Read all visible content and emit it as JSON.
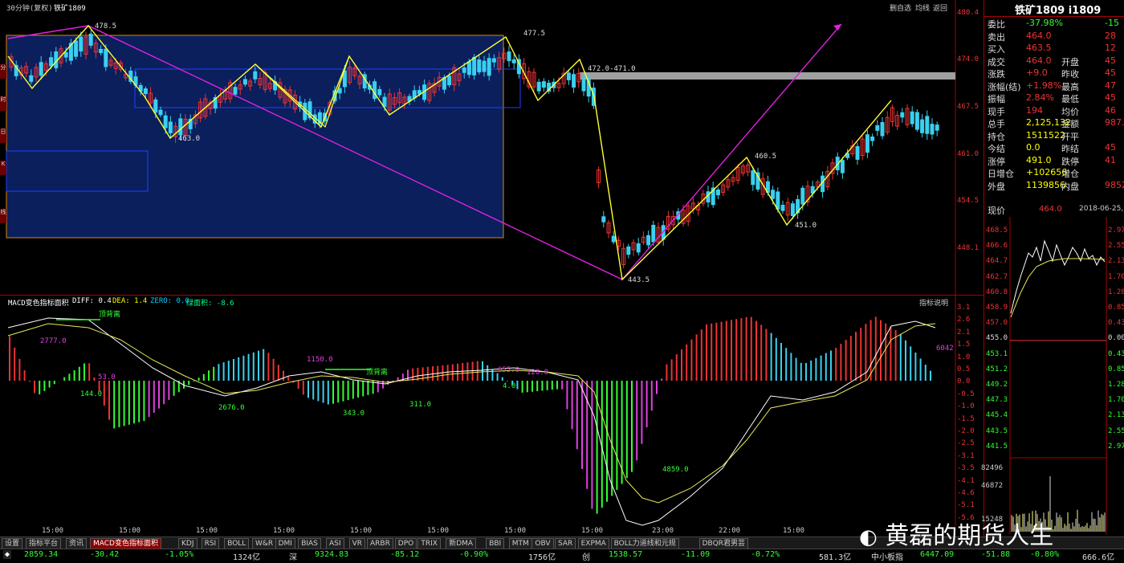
{
  "header": {
    "period": "30分钟(复权)",
    "symbol": "铁矿1809",
    "tools": [
      "删自选",
      "均线",
      "返回"
    ]
  },
  "price_axis": [
    "480.4",
    "474.0",
    "467.5",
    "461.0",
    "454.5",
    "448.1"
  ],
  "main_labels": {
    "p1": "478.5",
    "p2": "463.0",
    "p3": "477.5",
    "p4": "472.0-471.0",
    "p5": "443.5",
    "p6": "460.5",
    "p7": "451.0"
  },
  "macd": {
    "title": "MACD变色指标面积",
    "diff": "DIFF: 0.4",
    "dea": "DEA: 1.4",
    "zero": "ZERO: 0.0",
    "area": "绿面积: -8.6",
    "help": "指标说明",
    "axis": [
      "3.1",
      "2.6",
      "2.1",
      "1.5",
      "1.0",
      "0.5",
      "0.0",
      "-0.5",
      "-1.0",
      "-1.5",
      "-2.0",
      "-2.5",
      "-3.1",
      "-3.5",
      "-4.1",
      "-4.6",
      "-5.1",
      "-5.6"
    ],
    "labels": {
      "a1": "2777.0",
      "a2": "144.0",
      "a3": "53.0",
      "a4": "2676.0",
      "a5": "343.0",
      "a6": "311.0",
      "a7": "1150.0",
      "a8": "655.0",
      "a9": "4.0",
      "a10": "128.0",
      "a11": "4859.0",
      "a12": "6042",
      "div1": "顶背离",
      "div2": "顶背离"
    },
    "time_axis": [
      "15:00",
      "15:00",
      "15:00",
      "15:00",
      "15:00",
      "15:00",
      "15:00",
      "15:00",
      "23:00",
      "22:00",
      "15:00"
    ]
  },
  "quote": {
    "title": "铁矿1809 i1809",
    "rows": [
      {
        "k1": "委比",
        "v1": "-37.98%",
        "k2": "",
        "v2": "-15"
      },
      {
        "k1": "卖出",
        "v1": "464.0",
        "k2": "",
        "v2": "28"
      },
      {
        "k1": "买入",
        "v1": "463.5",
        "k2": "",
        "v2": "12"
      },
      {
        "k1": "成交",
        "v1": "464.0",
        "k2": "开盘",
        "v2": "45"
      },
      {
        "k1": "涨跌",
        "v1": "+9.0",
        "k2": "昨收",
        "v2": "45"
      },
      {
        "k1": "涨幅(结)",
        "v1": "+1.98%",
        "k2": "最高",
        "v2": "47"
      },
      {
        "k1": "振幅",
        "v1": "2.84%",
        "k2": "最低",
        "v2": "45"
      },
      {
        "k1": "现手",
        "v1": "194",
        "k2": "均价",
        "v2": "46"
      },
      {
        "k1": "总手",
        "v1": "2,125,132",
        "k2": "金额",
        "v2": "987.4"
      },
      {
        "k1": "持仓",
        "v1": "1511522",
        "k2": "开平",
        "v2": ""
      },
      {
        "k1": "今结",
        "v1": "0.0",
        "k2": "昨结",
        "v2": "45"
      },
      {
        "k1": "涨停",
        "v1": "491.0",
        "k2": "跌停",
        "v2": "41"
      },
      {
        "k1": "日增仓",
        "v1": "+102656",
        "k2": "增仓",
        "v2": ""
      },
      {
        "k1": "外盘",
        "v1": "1139856",
        "k2": "内盘",
        "v2": "9852"
      }
    ],
    "now_label": "现价",
    "now_value": "464.0",
    "date": "2018-06-25,"
  },
  "mini_axis_left": [
    "468.5",
    "466.6",
    "464.7",
    "462.7",
    "460.8",
    "458.9",
    "457.0",
    "455.0",
    "453.1",
    "451.2",
    "449.2",
    "447.3",
    "445.4",
    "443.5",
    "441.5"
  ],
  "mini_axis_right": [
    "2.97",
    "2.55",
    "2.13",
    "1.70",
    "1.28",
    "0.85",
    "0.43",
    "0.00",
    "0.43",
    "0.85",
    "1.28",
    "1.70",
    "2.13",
    "2.55",
    "2.97"
  ],
  "mini_vol": [
    "82496",
    "46872",
    "15248"
  ],
  "tabs": [
    "设置",
    "指标平台",
    "资讯",
    "MACD变色指标面积",
    "KDJ",
    "RSI",
    "BOLL",
    "W&R",
    "DMI",
    "BIAS",
    "ASI",
    "VR",
    "ARBR",
    "DPO",
    "TRIX",
    "新DMA",
    "BBI",
    "MTM",
    "OBV",
    "SAR",
    "EXPMA",
    "BOLL力道线和元规",
    "DBQR君男芸"
  ],
  "status": {
    "s1": "2859.34",
    "s2": "-30.42",
    "s3": "-1.05%",
    "s4": "1324亿",
    "s5": "深",
    "s6": "9324.83",
    "s7": "-85.12",
    "s8": "-0.90%",
    "s9": "1756亿",
    "s10": "创",
    "s11": "1538.57",
    "s12": "-11.09",
    "s13": "-0.72%",
    "s14": "581.3亿",
    "s15": "中小板指",
    "s16": "6447.09",
    "s17": "-51.88",
    "s18": "-0.80%",
    "s19": "666.6亿"
  },
  "watermark": "黄磊的期货人生",
  "side_tabs": [
    "分",
    "时",
    "日",
    "K",
    "线"
  ]
}
